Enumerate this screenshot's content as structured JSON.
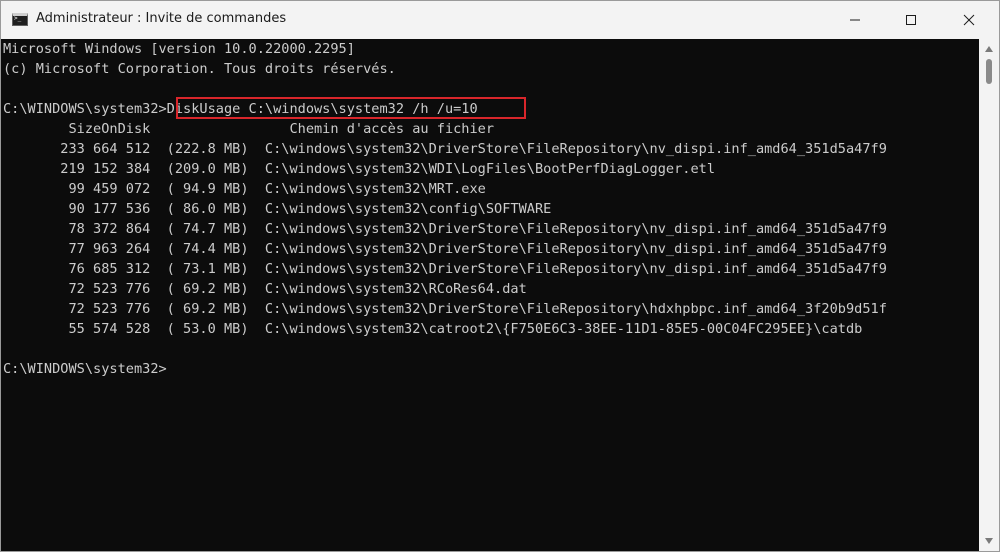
{
  "window": {
    "title": "Administrateur : Invite de commandes",
    "icon": "cmd-icon",
    "controls": [
      "minimize-icon",
      "maximize-icon",
      "close-icon"
    ]
  },
  "colors": {
    "console_bg": "#0c0c0c",
    "console_text": "#cccccc",
    "highlight_border": "#d9262b",
    "titlebar_bg": "#f3f3f3"
  },
  "console": {
    "lines": [
      "Microsoft Windows [version 10.0.22000.2295]",
      "(c) Microsoft Corporation. Tous droits réservés.",
      "",
      "C:\\WINDOWS\\system32>DiskUsage C:\\windows\\system32 /h /u=10",
      "        SizeOnDisk                 Chemin d'accès au fichier",
      "       233 664 512  (222.8 MB)  C:\\windows\\system32\\DriverStore\\FileRepository\\nv_dispi.inf_amd64_351d5a47f9",
      "       219 152 384  (209.0 MB)  C:\\windows\\system32\\WDI\\LogFiles\\BootPerfDiagLogger.etl",
      "        99 459 072  ( 94.9 MB)  C:\\windows\\system32\\MRT.exe",
      "        90 177 536  ( 86.0 MB)  C:\\windows\\system32\\config\\SOFTWARE",
      "        78 372 864  ( 74.7 MB)  C:\\windows\\system32\\DriverStore\\FileRepository\\nv_dispi.inf_amd64_351d5a47f9",
      "        77 963 264  ( 74.4 MB)  C:\\windows\\system32\\DriverStore\\FileRepository\\nv_dispi.inf_amd64_351d5a47f9",
      "        76 685 312  ( 73.1 MB)  C:\\windows\\system32\\DriverStore\\FileRepository\\nv_dispi.inf_amd64_351d5a47f9",
      "        72 523 776  ( 69.2 MB)  C:\\windows\\system32\\RCoRes64.dat",
      "        72 523 776  ( 69.2 MB)  C:\\windows\\system32\\DriverStore\\FileRepository\\hdxhpbpc.inf_amd64_3f20b9d51f",
      "        55 574 528  ( 53.0 MB)  C:\\windows\\system32\\catroot2\\{F750E6C3-38EE-11D1-85E5-00C04FC295EE}\\catdb",
      "",
      "C:\\WINDOWS\\system32>"
    ]
  }
}
